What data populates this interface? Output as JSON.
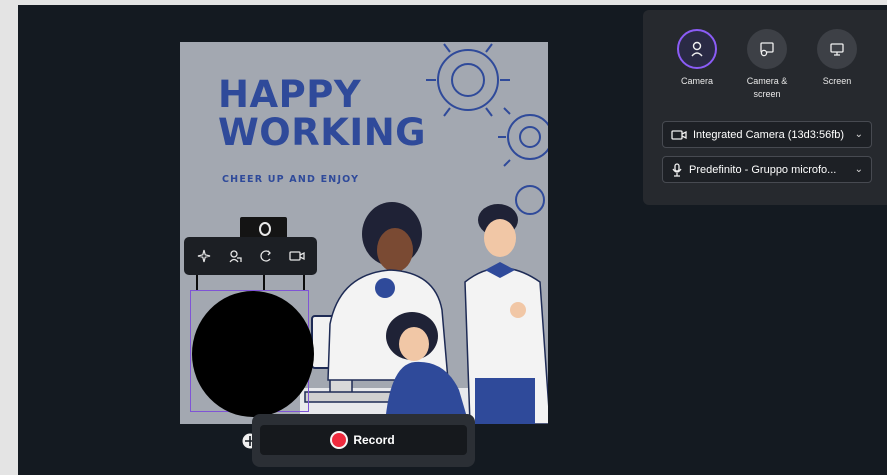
{
  "poster": {
    "title_line1": "HAPPY",
    "title_line2": "WORKING",
    "subtitle": "CHEER UP AND ENJOY"
  },
  "camera_toolbar": {
    "icons": [
      "sparkle-effects-icon",
      "background-person-icon",
      "rotate-icon",
      "camera-icon"
    ]
  },
  "record_bar": {
    "record_label": "Record",
    "colors": {
      "record_dot": "#ef2b3e"
    }
  },
  "panel": {
    "modes": [
      {
        "id": "camera",
        "label_line1": "Camera",
        "label_line2": "",
        "icon": "person-icon",
        "active": true
      },
      {
        "id": "camera_screen",
        "label_line1": "Camera &",
        "label_line2": "screen",
        "icon": "camera-screen-icon",
        "active": false
      },
      {
        "id": "screen",
        "label_line1": "Screen",
        "label_line2": "",
        "icon": "monitor-icon",
        "active": false
      }
    ],
    "camera_select": {
      "value": "Integrated Camera (13d3:56fb)",
      "icon": "video-camera-icon"
    },
    "mic_select": {
      "value": "Predefinito - Gruppo microfo...",
      "icon": "microphone-icon"
    },
    "accent_color": "#8b5cf6"
  }
}
